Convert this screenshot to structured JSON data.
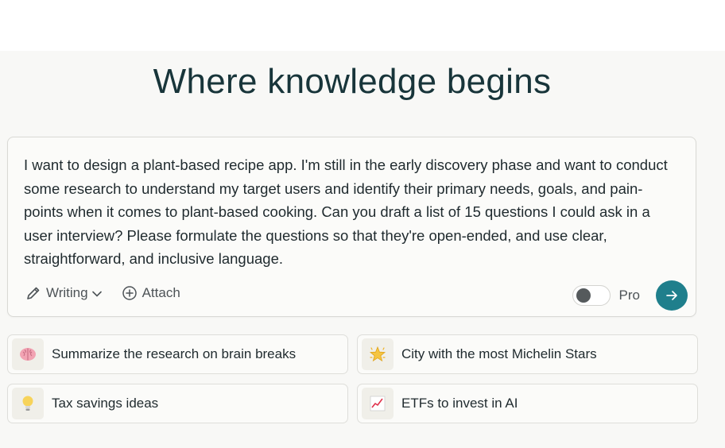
{
  "heading": "Where knowledge begins",
  "composer": {
    "prompt_text": "I want to design a plant-based recipe app. I'm still in the early discovery phase and want to conduct some research to understand my target users and identify their primary needs, goals, and pain-points when it comes to plant-based cooking. Can you draft a list of 15 questions I could ask in a user interview? Please formulate the questions so that they're open-ended, and use clear, straightforward, and inclusive language.",
    "focus_label": "Writing",
    "attach_label": "Attach",
    "pro_label": "Pro",
    "pro_enabled": false,
    "icons": {
      "focus": "pencil-icon",
      "focus_dropdown": "chevron-down-icon",
      "attach": "plus-circle-icon",
      "submit": "arrow-right-icon"
    }
  },
  "suggestions": [
    {
      "label": "Summarize the research on brain breaks",
      "icon": "brain-emoji"
    },
    {
      "label": "City with the most Michelin Stars",
      "icon": "sparkle-star-emoji"
    },
    {
      "label": "Tax savings ideas",
      "icon": "light-bulb-emoji"
    },
    {
      "label": "ETFs to invest in AI",
      "icon": "chart-increasing-emoji"
    }
  ],
  "colors": {
    "accent": "#1f7f8c",
    "heading": "#18353a",
    "background": "#f8f8f6"
  }
}
